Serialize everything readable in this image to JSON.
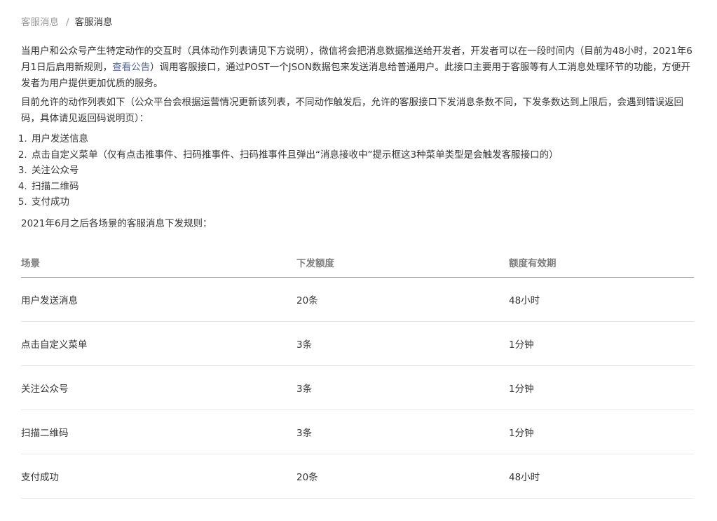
{
  "breadcrumb": {
    "parent": "客服消息",
    "separator": "/",
    "current": "客服消息"
  },
  "intro": {
    "text_before_link": "当用户和公众号产生特定动作的交互时（具体动作列表请见下方说明），微信将会把消息数据推送给开发者，开发者可以在一段时间内（目前为48小时，2021年6月1日后启用新规则，",
    "link_text": "查看公告",
    "text_after_link": "）调用客服接口，通过POST一个JSON数据包来发送消息给普通用户。此接口主要用于客服等有人工消息处理环节的功能，方便开发者为用户提供更加优质的服务。"
  },
  "allowed_actions_intro": "目前允许的动作列表如下（公众平台会根据运营情况更新该列表，不同动作触发后，允许的客服接口下发消息条数不同，下发条数达到上限后，会遇到错误返回码，具体请见返回码说明页）：",
  "actions": [
    "用户发送信息",
    "点击自定义菜单（仅有点击推事件、扫码推事件、扫码推事件且弹出“消息接收中”提示框这3种菜单类型是会触发客服接口的）",
    "关注公众号",
    "扫描二维码",
    "支付成功"
  ],
  "rules_title": "2021年6月之后各场景的客服消息下发规则：",
  "table": {
    "headers": [
      "场景",
      "下发额度",
      "额度有效期"
    ],
    "rows": [
      [
        "用户发送消息",
        "20条",
        "48小时"
      ],
      [
        "点击自定义菜单",
        "3条",
        "1分钟"
      ],
      [
        "关注公众号",
        "3条",
        "1分钟"
      ],
      [
        "扫描二维码",
        "3条",
        "1分钟"
      ],
      [
        "支付成功",
        "20条",
        "48小时"
      ]
    ]
  },
  "colors": {
    "text": "#353535",
    "muted": "#9a9a9a",
    "link": "#576b95",
    "header_text": "#7e7e7e",
    "row_border": "#e7e7e7"
  }
}
